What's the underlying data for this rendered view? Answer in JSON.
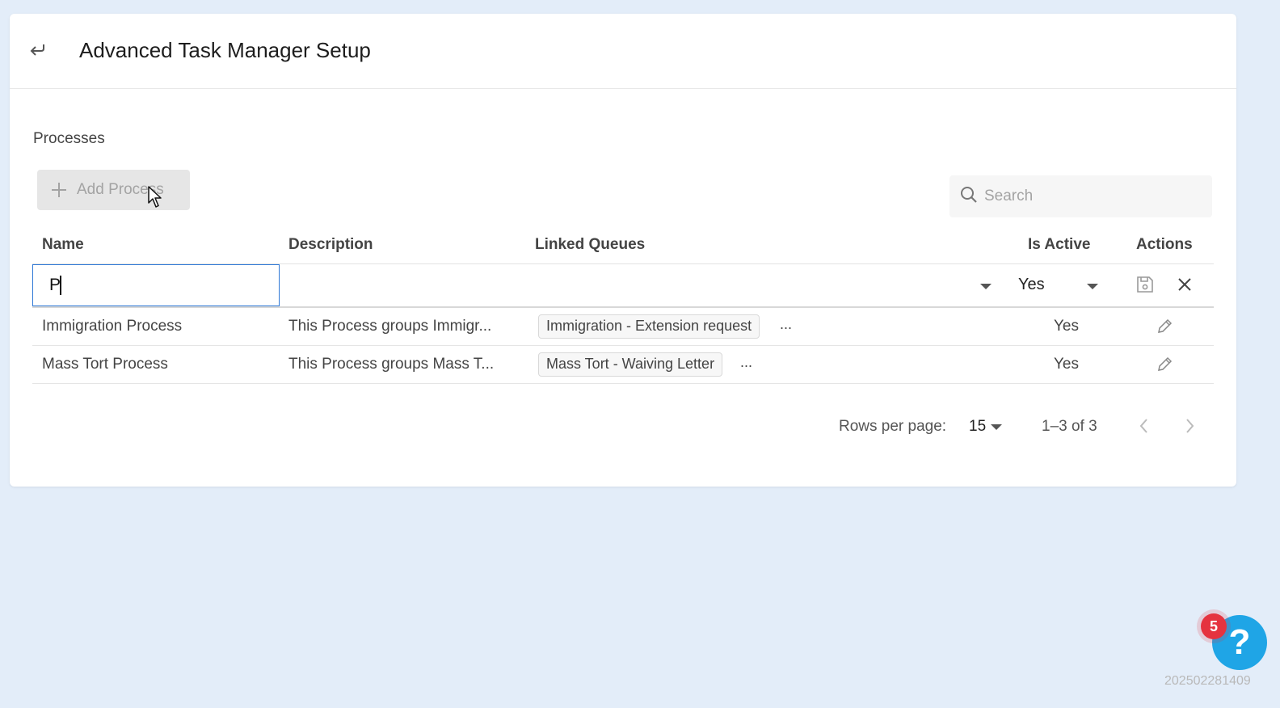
{
  "header": {
    "back_icon": "back-arrow-icon",
    "title": "Advanced Task Manager Setup"
  },
  "section": {
    "title": "Processes"
  },
  "toolbar": {
    "add_label": "Add Process",
    "search_placeholder": "Search"
  },
  "table": {
    "columns": [
      "Name",
      "Description",
      "Linked Queues",
      "Is Active",
      "Actions"
    ],
    "edit_row": {
      "name_value": "P",
      "is_active": "Yes"
    },
    "rows": [
      {
        "name": "Immigration Process",
        "description": "This Process groups Immigr...",
        "queue_chip": "Immigration - Extension request",
        "more": "...",
        "is_active": "Yes"
      },
      {
        "name": "Mass Tort Process",
        "description": "This Process groups Mass T...",
        "queue_chip": "Mass Tort - Waiving Letter",
        "more": "...",
        "is_active": "Yes"
      }
    ]
  },
  "pagination": {
    "rows_per_page_label": "Rows per page:",
    "rows_per_page": "15",
    "range": "1–3 of 3"
  },
  "help": {
    "badge_count": "5",
    "icon_label": "?"
  },
  "footer": {
    "build_id": "202502281409"
  },
  "colors": {
    "background": "#e3edf9",
    "accent": "#2e78d6",
    "help_button": "#1fa5e6",
    "badge": "#e5333f"
  }
}
